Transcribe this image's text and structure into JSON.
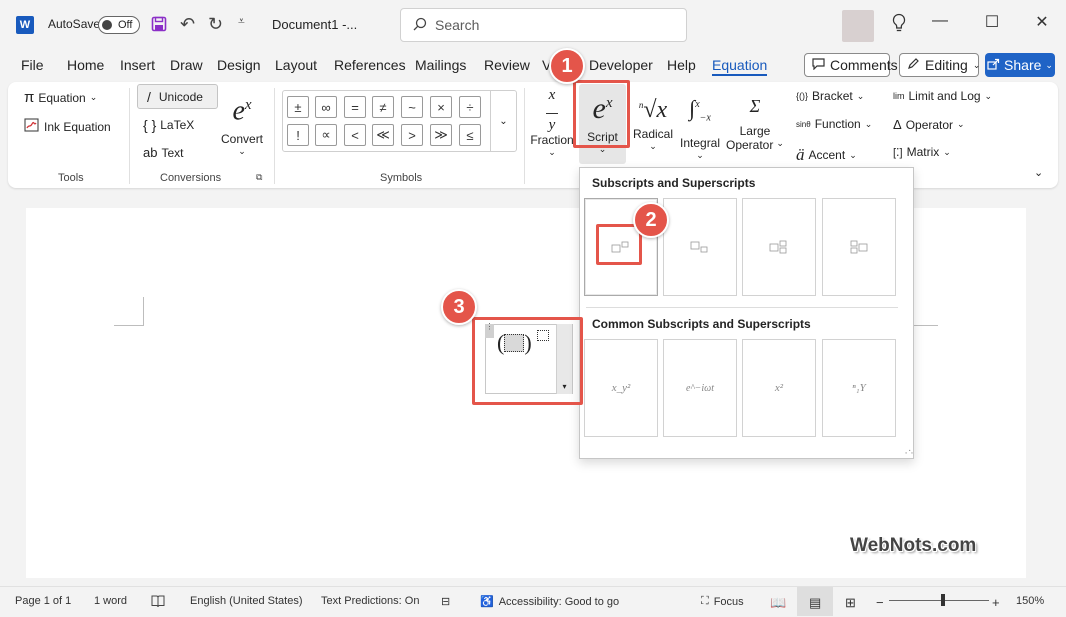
{
  "titlebar": {
    "app_icon": "word-logo",
    "app_letter": "W",
    "autosave_label": "AutoSave",
    "autosave_state": "Off",
    "doc_title": "Document1  -...",
    "search_placeholder": "Search",
    "icons": [
      "save-icon",
      "undo-icon",
      "redo-icon",
      "customize-qat-icon",
      "lightbulb-icon",
      "minimize-icon",
      "maximize-icon",
      "close-icon"
    ]
  },
  "menu": {
    "tabs": [
      "File",
      "Home",
      "Insert",
      "Draw",
      "Design",
      "Layout",
      "References",
      "Mailings",
      "Review",
      "V",
      "Developer",
      "Help",
      "Equation"
    ],
    "active_tab": "Equation",
    "comments": "Comments",
    "editing": "Editing",
    "share": "Share"
  },
  "ribbon": {
    "tools": {
      "equation": "Equation",
      "ink_equation": "Ink Equation",
      "label": "Tools"
    },
    "conversions": {
      "unicode": "Unicode",
      "latex": "LaTeX",
      "text": "Text",
      "convert": "Convert",
      "label": "Conversions"
    },
    "symbols": {
      "items": [
        "±",
        "∞",
        "=",
        "≠",
        "~",
        "×",
        "÷",
        "!",
        "∝",
        "<",
        "≪",
        ">",
        "≫",
        "≤"
      ],
      "label": "Symbols"
    },
    "structures": {
      "fraction": "Fraction",
      "script": "Script",
      "radical": "Radical",
      "integral": "Integral",
      "large_operator_1": "Large",
      "large_operator_2": "Operator",
      "bracket": "Bracket",
      "function": "Function",
      "accent": "Accent",
      "limit_and_log": "Limit and Log",
      "operator": "Operator",
      "matrix": "Matrix"
    }
  },
  "script_panel": {
    "section1": "Subscripts and Superscripts",
    "section2": "Common Subscripts and Superscripts",
    "common_tiles": [
      "x_y²",
      "e^−iωt",
      "x²",
      "ⁿ₁Y"
    ]
  },
  "annotations": [
    "1",
    "2",
    "3"
  ],
  "watermark": "WebNots.com",
  "status": {
    "page": "Page 1 of 1",
    "words": "1 word",
    "language": "English (United States)",
    "predictions": "Text Predictions: On",
    "accessibility": "Accessibility: Good to go",
    "focus": "Focus",
    "zoom": "150%"
  },
  "colors": {
    "accent": "#185abd",
    "share": "#1f63c6",
    "annotation": "#e4554a"
  }
}
